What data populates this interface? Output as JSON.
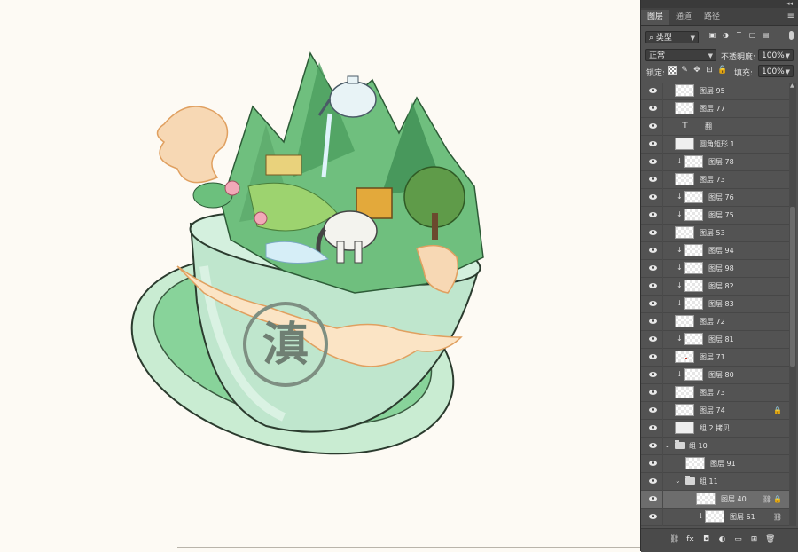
{
  "panel": {
    "collapse_glyph": "◂◂",
    "close_glyph": "✕",
    "tabs": [
      {
        "label": "图层",
        "active": true
      },
      {
        "label": "通道",
        "active": false
      },
      {
        "label": "路径",
        "active": false
      }
    ],
    "menu_icon": "menu-icon",
    "filter": {
      "kind_label": "类型",
      "search_glyph": "⌕"
    },
    "blend_mode": "正常",
    "opacity_label": "不透明度:",
    "opacity_value": "100%",
    "lock_label": "锁定:",
    "fill_label": "填充:",
    "fill_value": "100%"
  },
  "layers": [
    {
      "name": "图层 95",
      "type": "pixel",
      "clip": false,
      "indent": 0
    },
    {
      "name": "图层 77",
      "type": "pixel",
      "clip": false,
      "indent": 0
    },
    {
      "name": "翻",
      "type": "text",
      "clip": false,
      "indent": 0
    },
    {
      "name": "圆角矩形 1",
      "type": "shape",
      "clip": false,
      "indent": 0
    },
    {
      "name": "图层 78",
      "type": "pixel",
      "clip": true,
      "indent": 0
    },
    {
      "name": "图层 73",
      "type": "pixel",
      "clip": false,
      "indent": 0
    },
    {
      "name": "图层 76",
      "type": "pixel",
      "clip": true,
      "indent": 0
    },
    {
      "name": "图层 75",
      "type": "pixel",
      "clip": true,
      "indent": 0
    },
    {
      "name": "图层 53",
      "type": "pixel",
      "clip": false,
      "indent": 0
    },
    {
      "name": "图层 94",
      "type": "pixel",
      "clip": true,
      "indent": 0
    },
    {
      "name": "图层 98",
      "type": "pixel",
      "clip": true,
      "indent": 0
    },
    {
      "name": "图层 82",
      "type": "pixel",
      "clip": true,
      "indent": 0
    },
    {
      "name": "图层 83",
      "type": "pixel",
      "clip": true,
      "indent": 0
    },
    {
      "name": "图层 72",
      "type": "pixel",
      "clip": false,
      "indent": 0
    },
    {
      "name": "图层 81",
      "type": "pixel",
      "clip": true,
      "indent": 0
    },
    {
      "name": "图层 71",
      "type": "pixel",
      "clip": false,
      "indent": 0,
      "mark": true
    },
    {
      "name": "图层 80",
      "type": "pixel",
      "clip": true,
      "indent": 0
    },
    {
      "name": "图层 73",
      "type": "pixel",
      "clip": false,
      "indent": 0
    },
    {
      "name": "图层 74",
      "type": "pixel",
      "clip": false,
      "indent": 0,
      "locked": true
    },
    {
      "name": "组 2 拷贝",
      "type": "smart",
      "clip": false,
      "indent": 0
    },
    {
      "name": "组 10",
      "type": "group",
      "clip": false,
      "indent": 0,
      "open": true
    },
    {
      "name": "图层 91",
      "type": "pixel",
      "clip": false,
      "indent": 1
    },
    {
      "name": "组 11",
      "type": "group",
      "clip": false,
      "indent": 1,
      "open": true
    },
    {
      "name": "图层 40",
      "type": "pixel",
      "clip": false,
      "indent": 2,
      "selected": true,
      "locked": true,
      "linked": true
    },
    {
      "name": "图层 61",
      "type": "pixel",
      "clip": true,
      "indent": 2,
      "linked": true
    }
  ],
  "bottom_icons": [
    "link-icon",
    "fx-icon",
    "mask-icon",
    "adjustment-icon",
    "new-group-icon",
    "new-layer-icon",
    "delete-icon"
  ],
  "artwork": {
    "seal_text": "滇"
  }
}
